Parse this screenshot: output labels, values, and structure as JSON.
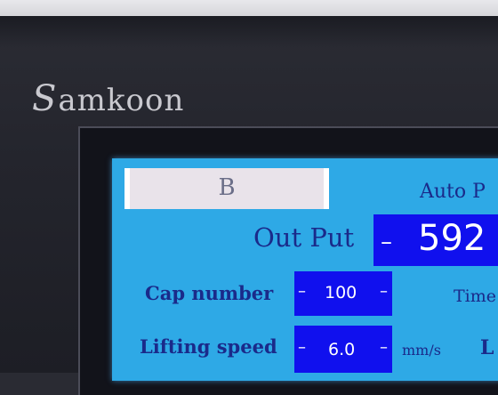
{
  "brand": {
    "first_letter": "S",
    "rest": "amkoon"
  },
  "hmi": {
    "mode_button": "B",
    "auto_label": "Auto P",
    "output_label": "Out Put",
    "output_value": "592",
    "cap_number_label": "Cap number",
    "cap_number_value": "100",
    "time_label": "Time",
    "lifting_speed_label": "Lifting speed",
    "lifting_speed_value": "6.0",
    "lifting_speed_unit": "mm/s",
    "partial_label": "L"
  },
  "colors": {
    "screen_bg": "#2ea9e6",
    "value_box_bg": "#1010ee",
    "label_text": "#1a2a8a",
    "button_bg": "#e9e3ea"
  }
}
